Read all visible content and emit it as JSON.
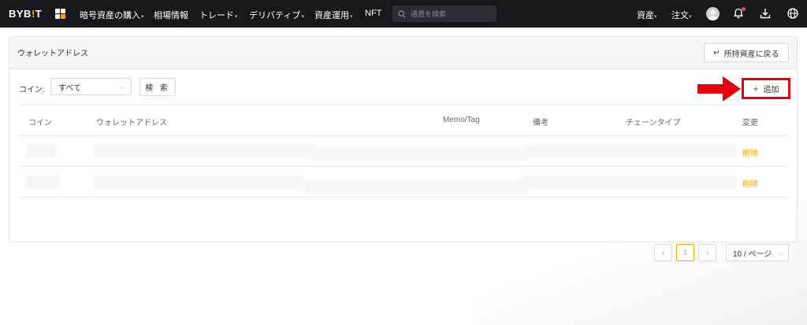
{
  "nav": {
    "logo_main": "BYB",
    "logo_accent": "!",
    "logo_end": "T",
    "items": [
      {
        "label": "暗号資産の購入",
        "caret": "▾"
      },
      {
        "label": "相場情報",
        "caret": ""
      },
      {
        "label": "トレード",
        "caret": "▾"
      },
      {
        "label": "デリバティブ",
        "caret": "▾"
      },
      {
        "label": "資産運用",
        "caret": "▾"
      },
      {
        "label": "NFT",
        "caret": ""
      }
    ],
    "search_placeholder": "通貨を検索",
    "assets_label": "資産",
    "orders_label": "注文",
    "caret": "▾"
  },
  "page": {
    "title": "ウォレットアドレス",
    "back_button": "所持資産に戻る"
  },
  "filter": {
    "coin_label": "コイン:",
    "coin_value": "すべて",
    "search_button": "検 索",
    "add_button": "追加"
  },
  "table": {
    "headers": [
      "コイン",
      "ウォレットアドレス",
      "Memo/Tag",
      "備考",
      "チェーンタイプ",
      "変更"
    ],
    "rows": [
      {
        "action": "削除"
      },
      {
        "action": "削除"
      }
    ]
  },
  "pagination": {
    "prev": "‹",
    "current": "1",
    "next": "›",
    "page_size": "10 / ページ"
  },
  "colors": {
    "accent": "#f7a600",
    "highlight": "#e3000f",
    "topbar": "#17181e"
  }
}
